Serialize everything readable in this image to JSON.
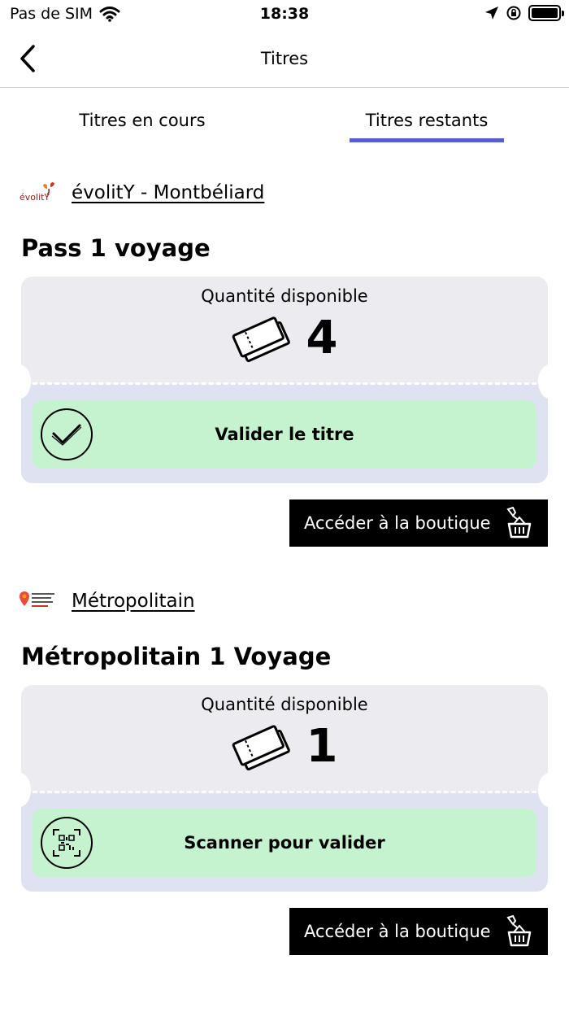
{
  "status_bar": {
    "carrier": "Pas de SIM",
    "time": "18:38"
  },
  "nav": {
    "title": "Titres"
  },
  "tabs": [
    {
      "label": "Titres en cours",
      "active": false
    },
    {
      "label": "Titres restants",
      "active": true
    }
  ],
  "accent_color": "#5160d8",
  "sections": [
    {
      "operator": "évolitY - Montbéliard",
      "product": "Pass 1 voyage",
      "quantity_label": "Quantité disponible",
      "quantity": "4",
      "action_label": "Valider le titre",
      "action_icon": "check-circle-icon",
      "shop_label": "Accéder à la boutique"
    },
    {
      "operator": "Métropolitain",
      "product": "Métropolitain 1 Voyage",
      "quantity_label": "Quantité disponible",
      "quantity": "1",
      "action_label": "Scanner pour valider",
      "action_icon": "qr-scan-icon",
      "shop_label": "Accéder à la boutique"
    }
  ]
}
